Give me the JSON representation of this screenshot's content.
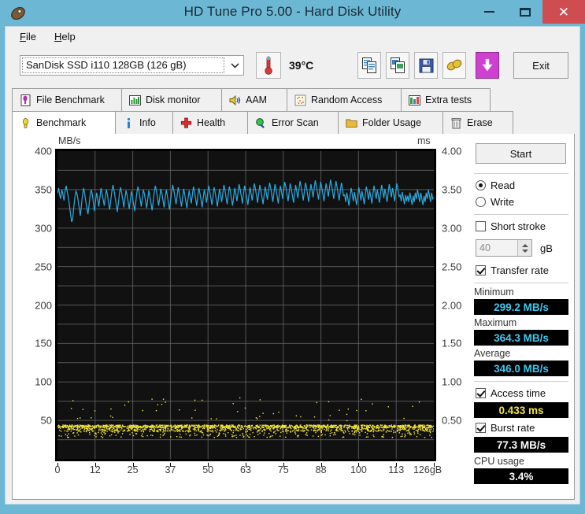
{
  "window": {
    "title": "HD Tune Pro 5.00 - Hard Disk Utility",
    "minimize_label": "",
    "maximize_label": "",
    "close_label": "✕"
  },
  "menu": {
    "file": "File",
    "help": "Help"
  },
  "toolbar": {
    "drive": "SanDisk SSD i110 128GB (126 gB)",
    "dropdown_arrow": "▼",
    "temperature": "39°C",
    "exit_label": "Exit",
    "buttons": [
      {
        "name": "copy-text-icon",
        "tip": "Copy to clipboard"
      },
      {
        "name": "copy-image-icon",
        "tip": "Copy screenshot"
      },
      {
        "name": "save-icon",
        "tip": "Save"
      },
      {
        "name": "peanut-icon",
        "tip": "Options"
      },
      {
        "name": "download-icon",
        "tip": "Download"
      }
    ]
  },
  "tabs": {
    "row1": [
      {
        "label": "File Benchmark",
        "icon": "file-benchmark-icon",
        "active": false
      },
      {
        "label": "Disk monitor",
        "icon": "disk-monitor-icon",
        "active": false
      },
      {
        "label": "AAM",
        "icon": "aam-icon",
        "active": false
      },
      {
        "label": "Random Access",
        "icon": "random-access-icon",
        "active": false
      },
      {
        "label": "Extra tests",
        "icon": "extra-tests-icon",
        "active": false
      }
    ],
    "row2": [
      {
        "label": "Benchmark",
        "icon": "benchmark-icon",
        "active": true
      },
      {
        "label": "Info",
        "icon": "info-icon",
        "active": false
      },
      {
        "label": "Health",
        "icon": "health-icon",
        "active": false
      },
      {
        "label": "Error Scan",
        "icon": "error-scan-icon",
        "active": false
      },
      {
        "label": "Folder Usage",
        "icon": "folder-usage-icon",
        "active": false
      },
      {
        "label": "Erase",
        "icon": "erase-icon",
        "active": false
      }
    ]
  },
  "sidebar": {
    "start_label": "Start",
    "read_label": "Read",
    "write_label": "Write",
    "read_selected": true,
    "write_selected": false,
    "short_stroke_label": "Short stroke",
    "short_stroke_checked": false,
    "short_stroke_value": "40",
    "short_stroke_unit": "gB",
    "transfer_rate_label": "Transfer rate",
    "transfer_rate_checked": true,
    "minimum_label": "Minimum",
    "minimum_value": "299.2 MB/s",
    "maximum_label": "Maximum",
    "maximum_value": "364.3 MB/s",
    "average_label": "Average",
    "average_value": "346.0 MB/s",
    "access_time_label": "Access time",
    "access_time_checked": true,
    "access_time_value": "0.433 ms",
    "burst_rate_label": "Burst rate",
    "burst_rate_checked": true,
    "burst_rate_value": "77.3 MB/s",
    "cpu_usage_label": "CPU usage",
    "cpu_usage_value": "3.4%"
  },
  "colors": {
    "transfer_line": "#29ace3",
    "access_dots": "#f2e53a",
    "plot_bg": "#111111",
    "grid": "#6b6b6b",
    "titlebar": "#6cb8d4",
    "close": "#cf4c51"
  },
  "chart_data": {
    "type": "line",
    "title": "",
    "xlabel": "gB",
    "ylabel": "MB/s",
    "y2label": "ms",
    "ylim": [
      0,
      400
    ],
    "y2lim": [
      0,
      4.0
    ],
    "xlim": [
      0,
      126
    ],
    "grid": true,
    "legend": "none",
    "yticks": [
      400,
      350,
      300,
      250,
      200,
      150,
      100,
      50
    ],
    "y2ticks": [
      "4.00",
      "3.50",
      "3.00",
      "2.50",
      "2.00",
      "1.50",
      "1.00",
      "0.50"
    ],
    "xticks": [
      "0",
      "12",
      "25",
      "37",
      "50",
      "63",
      "75",
      "88",
      "100",
      "113",
      "126gB"
    ],
    "series": [
      {
        "name": "Transfer rate",
        "axis": "left",
        "unit": "MB/s",
        "color": "#29ace3",
        "values": [
          345,
          352,
          343,
          338,
          350,
          344,
          336,
          349,
          355,
          347,
          340,
          330,
          318,
          308,
          312,
          327,
          340,
          348,
          344,
          336,
          326,
          316,
          329,
          343,
          352,
          345,
          335,
          326,
          318,
          330,
          342,
          350,
          344,
          333,
          322,
          335,
          346,
          338,
          328,
          340,
          352,
          345,
          337,
          329,
          341,
          350,
          343,
          332,
          324,
          336,
          348,
          356,
          349,
          340,
          330,
          321,
          333,
          345,
          353,
          346,
          337,
          327,
          338,
          349,
          343,
          334,
          325,
          337,
          348,
          340,
          331,
          322,
          334,
          346,
          354,
          347,
          338,
          328,
          339,
          350,
          344,
          335,
          326,
          338,
          349,
          341,
          332,
          323,
          335,
          347,
          355,
          348,
          339,
          329,
          340,
          351,
          345,
          336,
          327,
          339,
          350,
          342,
          333,
          324,
          336,
          348,
          356,
          349,
          340,
          331,
          342,
          353,
          346,
          337,
          328,
          340,
          351,
          344,
          335,
          326,
          338,
          349,
          341,
          332,
          343,
          354,
          347,
          338,
          329,
          341,
          352,
          345,
          336,
          327,
          339,
          350,
          342,
          333,
          344,
          355,
          348,
          339,
          330,
          342,
          353,
          346,
          337,
          328,
          340,
          351,
          343,
          334,
          345,
          356,
          349,
          340,
          331,
          343,
          354,
          347,
          338,
          329,
          341,
          352,
          344,
          335,
          346,
          357,
          350,
          341,
          332,
          344,
          355,
          348,
          339,
          330,
          342,
          353,
          345,
          336,
          347,
          358,
          351,
          342,
          333,
          345,
          356,
          349,
          340,
          331,
          343,
          354,
          346,
          337,
          348,
          359,
          352,
          343,
          334,
          346,
          357,
          350,
          341,
          332,
          344,
          355,
          347,
          338,
          349,
          360,
          353,
          344,
          335,
          347,
          358,
          351,
          342,
          333,
          345,
          356,
          348,
          339,
          350,
          361,
          354,
          345,
          336,
          348,
          359,
          352,
          343,
          334,
          346,
          357,
          349,
          340,
          351,
          362,
          355,
          346,
          337,
          349,
          360,
          353,
          344,
          335,
          347,
          358,
          350,
          341,
          352,
          363,
          356,
          347,
          338,
          350,
          361,
          354,
          345,
          336,
          348,
          359,
          351,
          342,
          343,
          334,
          346,
          338,
          329,
          341,
          352,
          344,
          335,
          347,
          339,
          330,
          342,
          353,
          345,
          336,
          348,
          340,
          331,
          343,
          354,
          346,
          337,
          349,
          341,
          332,
          344,
          355,
          347,
          338,
          350,
          342,
          333,
          345,
          356,
          348,
          339,
          351,
          343,
          334,
          346,
          357,
          349,
          340,
          352,
          344,
          335,
          347,
          358,
          350,
          341,
          343,
          335,
          347,
          339,
          331,
          343,
          335,
          342,
          334,
          346,
          338,
          330,
          342,
          334,
          346,
          338,
          350,
          342,
          334,
          346,
          338,
          330,
          342,
          334,
          346,
          338,
          350,
          342,
          334,
          346,
          338,
          340
        ]
      },
      {
        "name": "Access time",
        "axis": "right",
        "unit": "ms",
        "color": "#f2e53a",
        "mean": 0.433,
        "typical_range": [
          0.3,
          0.55
        ],
        "description": "dense scatter cloud clustered near 0.43 ms with sparse outliers up to ~0.80 ms"
      }
    ]
  }
}
